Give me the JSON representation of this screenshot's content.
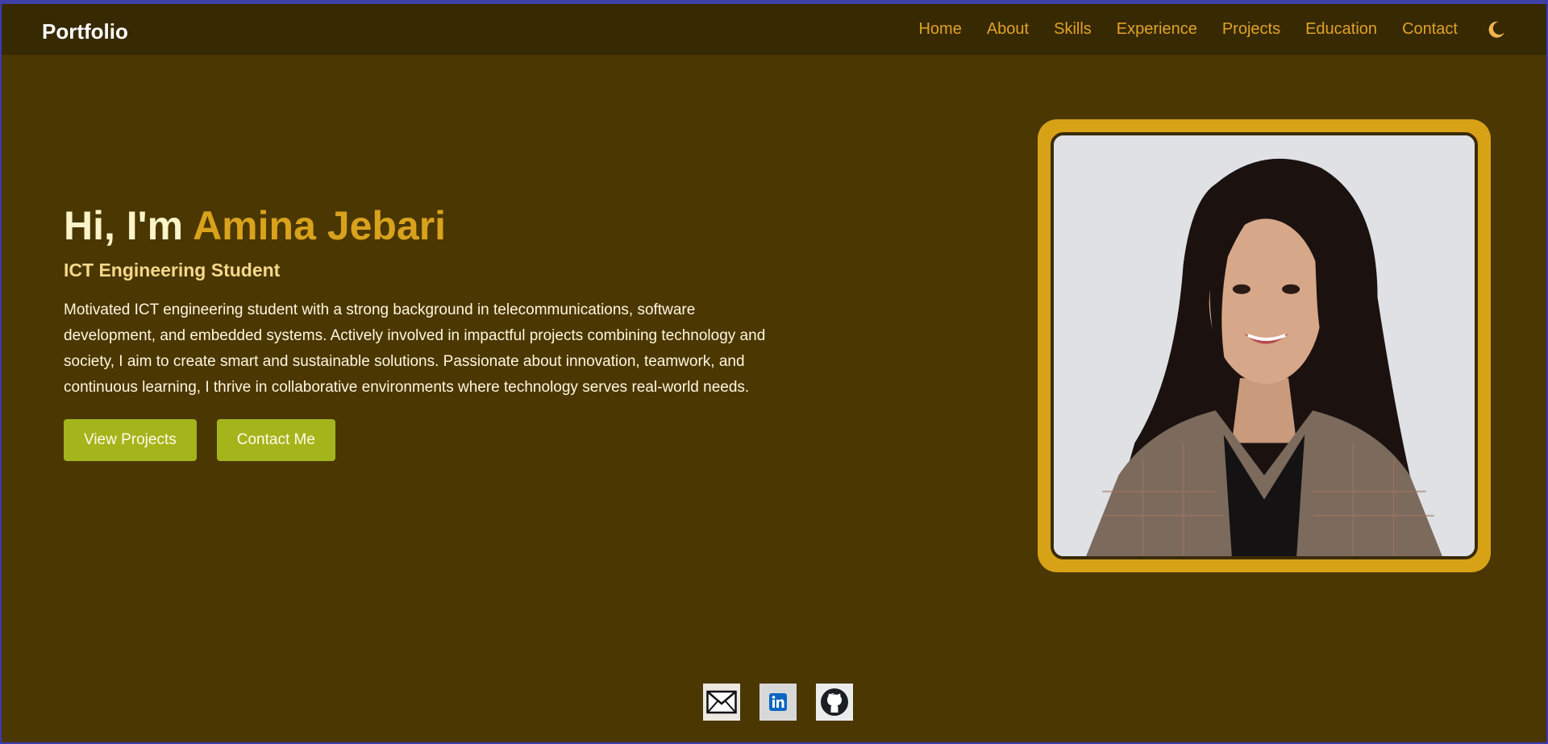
{
  "nav": {
    "brand": "Portfolio",
    "links": [
      "Home",
      "About",
      "Skills",
      "Experience",
      "Projects",
      "Education",
      "Contact"
    ],
    "theme_icon": "moon-icon"
  },
  "hero": {
    "greeting": "Hi, I'm ",
    "name": "Amina Jebari",
    "subtitle": "ICT Engineering Student",
    "description": "Motivated ICT engineering student with a strong background in telecommunications, software development, and embedded systems. Actively involved in impactful projects combining technology and society, I aim to create smart and sustainable solutions. Passionate about innovation, teamwork, and continuous learning, I thrive in collaborative environments where technology serves real-world needs.",
    "buttons": {
      "projects": "View Projects",
      "contact": "Contact Me"
    }
  },
  "photo": {
    "icon": "profile-photo"
  },
  "social": [
    {
      "icon": "mail-icon"
    },
    {
      "icon": "linkedin-icon"
    },
    {
      "icon": "github-icon"
    }
  ],
  "colors": {
    "background": "#4b3702",
    "navbar": "#372902",
    "accent": "#d8a21c",
    "button": "#a4b51c",
    "nav_link": "#e0a22a"
  }
}
